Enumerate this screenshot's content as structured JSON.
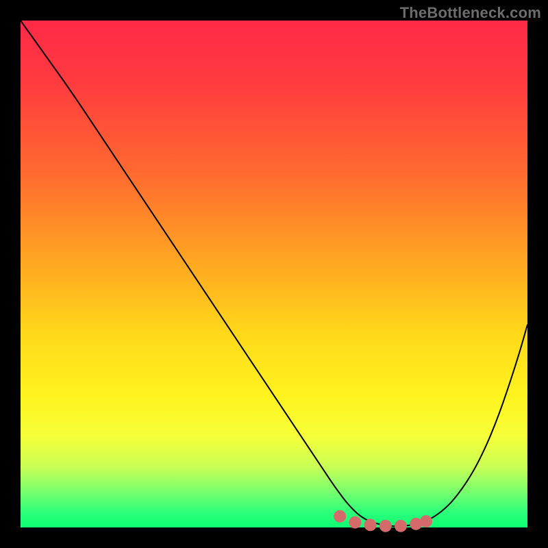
{
  "watermark": "TheBottleneck.com",
  "brand_color": "#6d6d6d",
  "chart_data": {
    "type": "line",
    "title": "",
    "xlabel": "",
    "ylabel": "",
    "xlim": [
      0,
      100
    ],
    "ylim": [
      0,
      100
    ],
    "grid": false,
    "legend": false,
    "curve_stroke": "#000000",
    "curve_stroke_width": 2,
    "marker_color": "#d46a6a",
    "marker_radius": 9,
    "series": [
      {
        "name": "curve",
        "x": [
          0,
          5,
          10,
          15,
          20,
          25,
          30,
          35,
          40,
          45,
          50,
          55,
          60,
          62,
          65,
          68,
          72,
          75,
          78,
          80,
          83,
          86,
          90,
          94,
          98,
          100
        ],
        "y": [
          100,
          93,
          86,
          78.5,
          71,
          63.5,
          56,
          48.5,
          41,
          33.5,
          26,
          18.5,
          11,
          8,
          4,
          1.4,
          0.3,
          0.2,
          0.6,
          1.2,
          3,
          6,
          12,
          21,
          33,
          40
        ]
      }
    ],
    "markers": [
      {
        "x": 63,
        "y": 2.2
      },
      {
        "x": 66,
        "y": 1.0
      },
      {
        "x": 69,
        "y": 0.5
      },
      {
        "x": 72,
        "y": 0.3
      },
      {
        "x": 75,
        "y": 0.3
      },
      {
        "x": 78,
        "y": 0.7
      },
      {
        "x": 80,
        "y": 1.2
      }
    ]
  }
}
